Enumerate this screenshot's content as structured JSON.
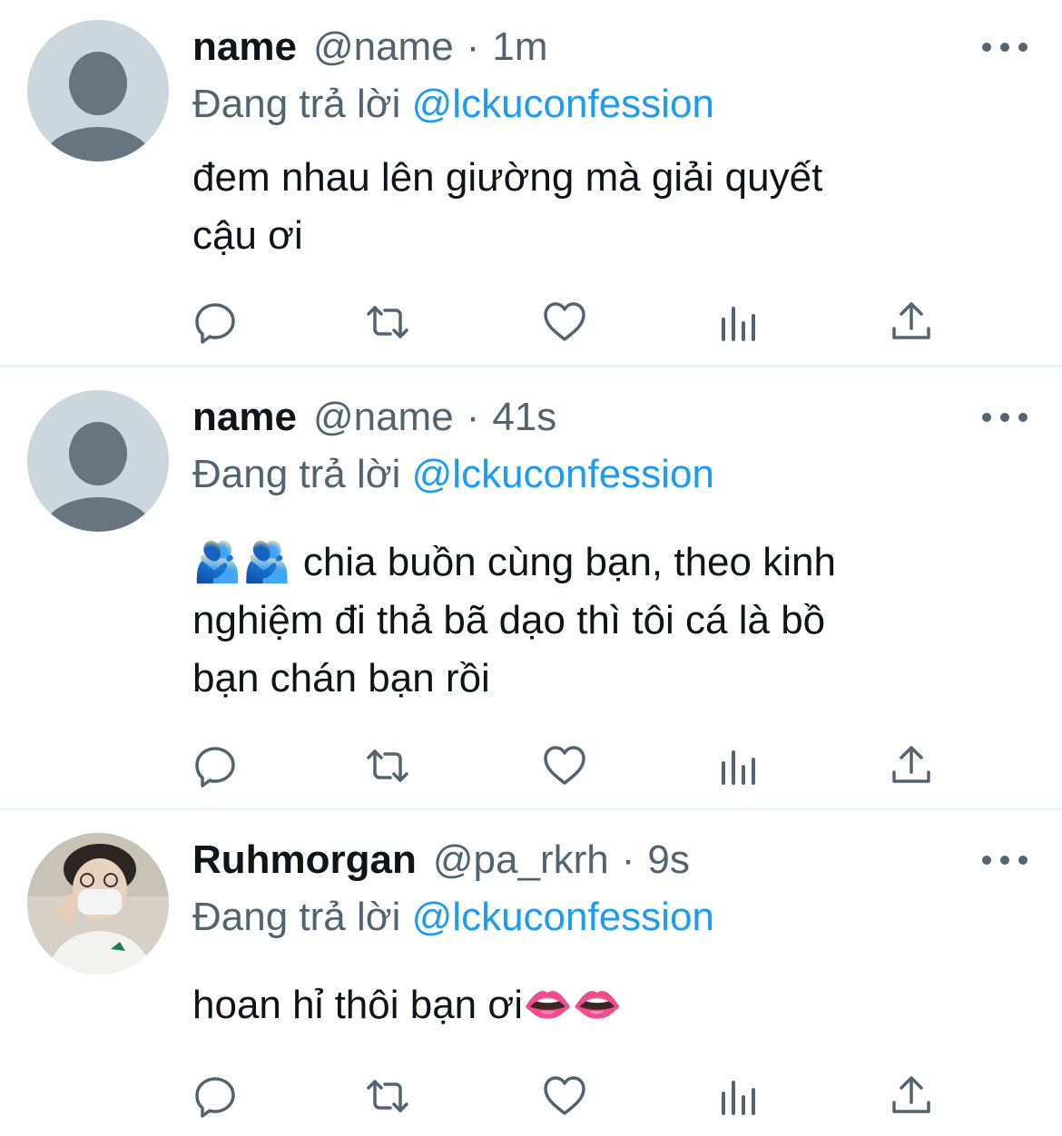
{
  "reply_prefix": "Đang trả lời",
  "tweets": [
    {
      "name": "name",
      "handle": "@name",
      "separator": "·",
      "time": "1m",
      "reply_to": "@lckuconfession",
      "lines": [
        "đem nhau lên giường mà giải quyết",
        "cậu ơi"
      ],
      "avatar": "default-avatar-icon"
    },
    {
      "name": "name",
      "handle": "@name",
      "separator": "·",
      "time": "41s",
      "reply_to": "@lckuconfession",
      "emoji_prefix": "🫂🫂",
      "lines": [
        "chia buồn cùng bạn, theo kinh",
        "nghiệm đi thả bã dạo thì tôi cá là bồ",
        "bạn chán bạn rồi"
      ],
      "avatar": "default-avatar-icon"
    },
    {
      "name": "Ruhmorgan",
      "handle": "@pa_rkrh",
      "separator": "·",
      "time": "9s",
      "reply_to": "@lckuconfession",
      "lines": [
        "hoan hỉ thôi bạn ơi"
      ],
      "emoji_suffix": "👄👄",
      "avatar": "photo-avatar-masked-person"
    }
  ],
  "colors": {
    "text": "#0f1419",
    "secondary": "#536471",
    "link": "#1d9bf0",
    "avatar_bg": "#ccd6dd",
    "divider": "#eff3f4"
  }
}
